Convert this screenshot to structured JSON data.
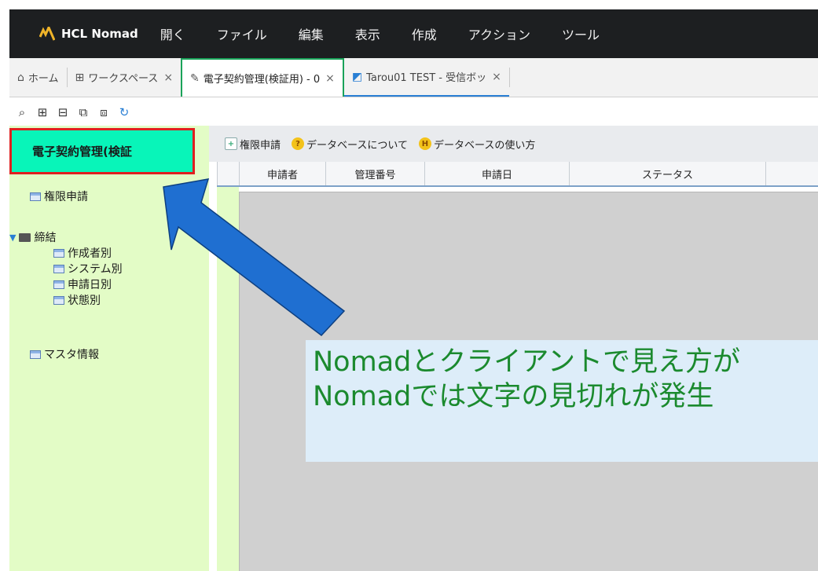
{
  "app": {
    "brand": "HCL Nomad"
  },
  "menu": [
    "開く",
    "ファイル",
    "編集",
    "表示",
    "作成",
    "アクション",
    "ツール"
  ],
  "tabs": [
    {
      "label": "ホーム",
      "icon": "home-icon"
    },
    {
      "label": "ワークスペース",
      "icon": "grid-icon"
    },
    {
      "label": "電子契約管理(検証用) - 0",
      "icon": "database-icon"
    },
    {
      "label": "Tarou01 TEST - 受信ボッ",
      "icon": "inbox-icon"
    }
  ],
  "toolbar_icons": [
    "search-icon",
    "expand-icon",
    "collapse-icon",
    "expand-all-icon",
    "collapse-all-icon",
    "refresh-icon"
  ],
  "nav": {
    "header": "電子契約管理(検証",
    "items": {
      "request": "権限申請",
      "folder": "締結",
      "by_author": "作成者別",
      "by_system": "システム別",
      "by_date": "申請日別",
      "by_status": "状態別",
      "master": "マスタ情報"
    }
  },
  "actions": {
    "request": "権限申請",
    "about": "データベースについて",
    "usage": "データベースの使い方",
    "about_badge": "?",
    "usage_badge": "H"
  },
  "columns": [
    "申請者",
    "管理番号",
    "申請日",
    "ステータス"
  ],
  "callout": {
    "line1": "Nomadとクライアントで見え方が",
    "line2": "Nomadでは文字の見切れが発生"
  },
  "colors": {
    "menubar": "#1d1f21",
    "nav_bg": "#e3fcc6",
    "nav_header": "#08f5b9",
    "highlight_border": "#e02020",
    "arrow": "#1f6fd1",
    "callout_text": "#1b8a2e",
    "callout_bg": "#ddedf9"
  }
}
